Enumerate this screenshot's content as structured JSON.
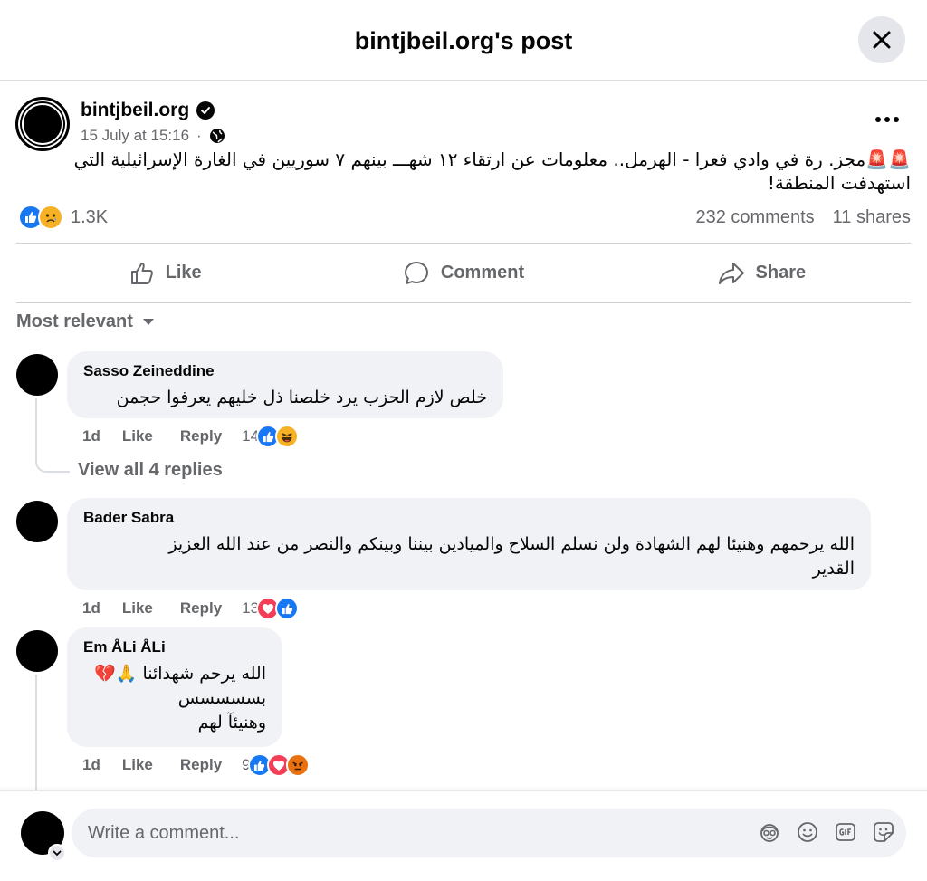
{
  "header": {
    "title": "bintjbeil.org's post"
  },
  "post": {
    "author": "bintjbeil.org",
    "date": "15 July at 15:16",
    "text_line1": "🚨🚨مجز. رة في وادي فعرا - الهرمل.. معلومات عن ارتقاء ١٢ شهـــ  بينهم ٧ سوريين في الغارة الإسرائيلية التي",
    "text_line2": "استهدفت المنطقة!",
    "reaction_count": "1.3K",
    "comments_count": "232 comments",
    "shares_count": "11 shares"
  },
  "actions": {
    "like": "Like",
    "comment": "Comment",
    "share": "Share"
  },
  "sort": {
    "label": "Most relevant"
  },
  "comments": [
    {
      "name": "Sasso Zeineddine",
      "text": "خلص لازم الحزب يرد خلصنا ذل خليهم يعرفوا حجمن",
      "age": "1d",
      "like": "Like",
      "reply": "Reply",
      "reaction_count": "14",
      "view_replies": "View all 4 replies"
    },
    {
      "name": "Bader Sabra",
      "text_line1": "الله يرحمهم وهنيئا لهم الشهادة ولن نسلم السلاح والميادين بيننا وبينكم والنصر من عند الله العزيز",
      "text_line2": "القدير",
      "age": "1d",
      "like": "Like",
      "reply": "Reply",
      "reaction_count": "13"
    },
    {
      "name": "Em ÅLi ÅLi",
      "text_line1": "الله يرحم شهدائنا 🙏💔",
      "text_line2": "بسسسسس",
      "text_line3": "وهنيئآ لهم",
      "age": "1d",
      "like": "Like",
      "reply": "Reply",
      "reaction_count": "9"
    }
  ],
  "composer": {
    "placeholder": "Write a comment..."
  },
  "colors": {
    "like_blue": "#1877f2",
    "love_red": "#f33e58",
    "haha_yellow": "#f7b125",
    "angry_orange": "#e9710f",
    "secondary_text": "#65676b"
  }
}
